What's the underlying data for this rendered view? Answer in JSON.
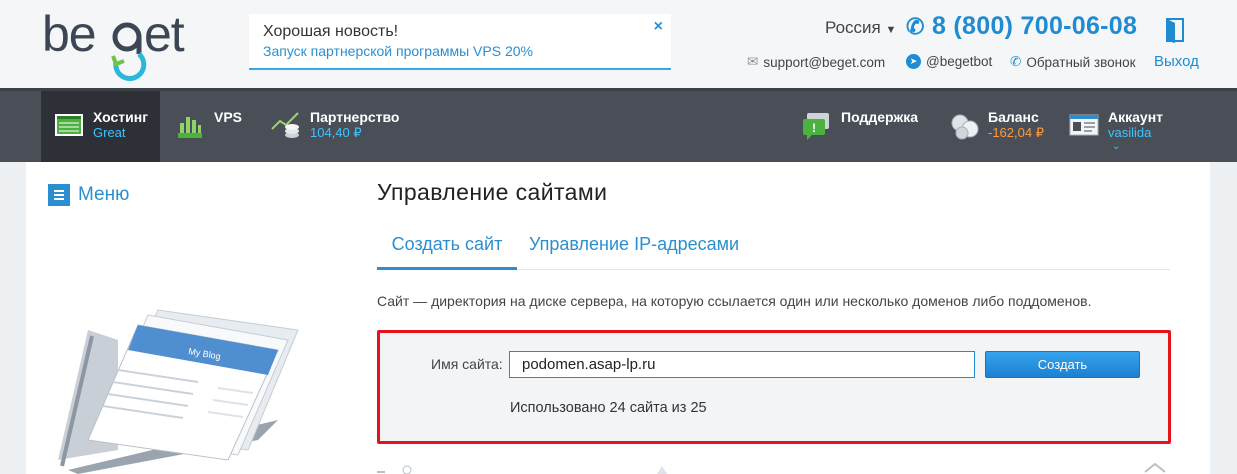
{
  "header": {
    "logo_text": "beget",
    "promo": {
      "title": "Хорошая новость!",
      "link": "Запуск партнерской программы VPS 20%",
      "close": "×"
    },
    "region": "Россия",
    "phone": "8 (800) 700-06-08",
    "email": "support@beget.com",
    "telegram": "@begetbot",
    "callback": "Обратный звонок",
    "logout": "Выход"
  },
  "nav": {
    "hosting": {
      "label": "Хостинг",
      "sub": "Great"
    },
    "vps": {
      "label": "VPS"
    },
    "partner": {
      "label": "Партнерство",
      "sub": "104,40 ₽"
    },
    "support": {
      "label": "Поддержка"
    },
    "balance": {
      "label": "Баланс",
      "sub": "-162,04 ₽"
    },
    "account": {
      "label": "Аккаунт",
      "sub": "vasilida"
    }
  },
  "sidebar": {
    "menu_label": "Меню"
  },
  "main": {
    "title": "Управление сайтами",
    "tabs": [
      {
        "label": "Создать сайт",
        "active": true
      },
      {
        "label": "Управление IP-адресами",
        "active": false
      }
    ],
    "description": "Сайт — директория на диске сервера, на которую ссылается один или несколько доменов либо поддоменов.",
    "form": {
      "label": "Имя сайта:",
      "value": "podomen.asap-lp.ru",
      "button": "Создать",
      "usage": "Использовано 24 сайта из 25"
    }
  },
  "colors": {
    "accent": "#1f8bd2",
    "nav_bg": "#4a4f57",
    "highlight_border": "#e3141b",
    "negative": "#ff9a3a"
  }
}
